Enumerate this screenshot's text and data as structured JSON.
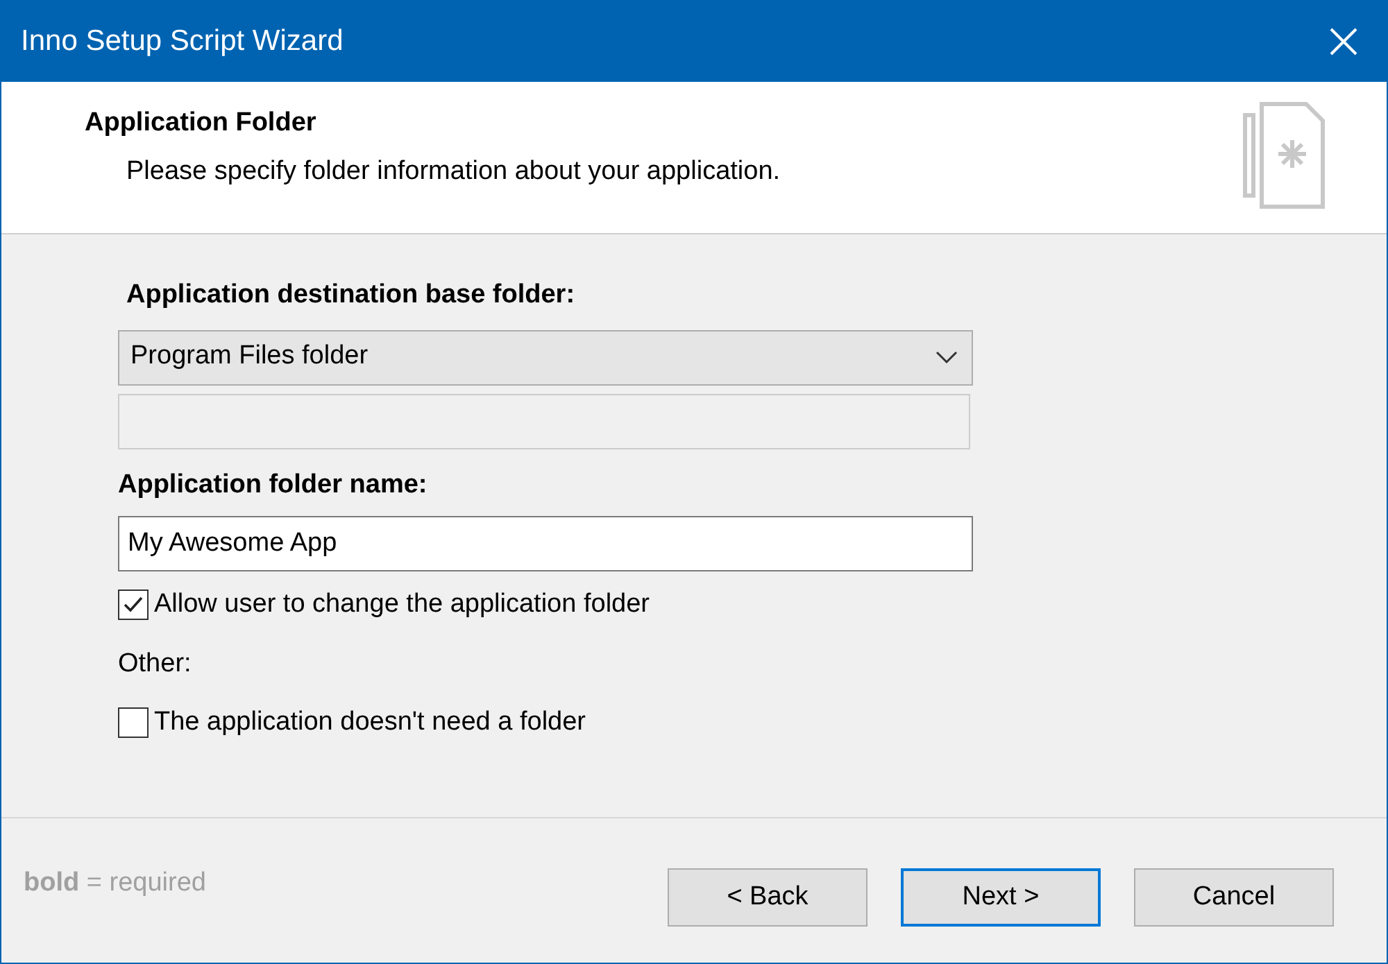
{
  "window": {
    "title": "Inno Setup Script Wizard"
  },
  "header": {
    "title": "Application Folder",
    "subtitle": "Please specify folder information about your application."
  },
  "base_folder": {
    "label": "Application destination base folder:",
    "value": "Program Files folder"
  },
  "custom_folder": {
    "disabled": true
  },
  "folder_name": {
    "label": "Application folder name:",
    "value": "My Awesome App"
  },
  "options": [
    {
      "label": "Allow user to change the application folder",
      "checked": true
    }
  ],
  "other_label": "Other:",
  "other_options": [
    {
      "label": "The application doesn't need a folder",
      "checked": false
    }
  ],
  "footer_hint": "**bold** = required",
  "buttons": [
    {
      "label": "< Back",
      "default": false
    },
    {
      "label": "Next >",
      "default": true
    },
    {
      "label": "Cancel",
      "default": false
    }
  ]
}
